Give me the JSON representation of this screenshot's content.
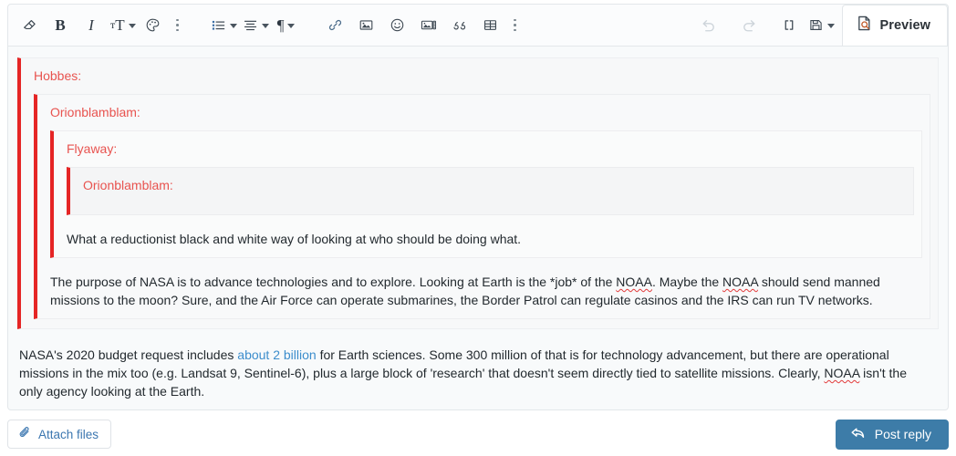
{
  "toolbar": {
    "groups": [
      {
        "name": "formatting",
        "buttons": [
          {
            "icon": "remove-format-icon",
            "label": "Remove formatting",
            "caret": false
          },
          {
            "icon": "bold-icon",
            "label": "Bold",
            "caret": false
          },
          {
            "icon": "italic-icon",
            "label": "Italic",
            "caret": false
          },
          {
            "icon": "font-size-icon",
            "label": "Font size",
            "caret": true
          },
          {
            "icon": "text-color-palette-icon",
            "label": "Text color",
            "caret": false
          },
          {
            "icon": "more-formatting-icon",
            "label": "More formatting options",
            "caret": false
          }
        ]
      },
      {
        "name": "paragraph",
        "buttons": [
          {
            "icon": "bulleted-list-icon",
            "label": "List",
            "caret": true
          },
          {
            "icon": "text-align-icon",
            "label": "Alignment",
            "caret": true
          },
          {
            "icon": "paragraph-format-icon",
            "label": "Paragraph format",
            "caret": true
          }
        ]
      },
      {
        "name": "insert",
        "buttons": [
          {
            "icon": "link-icon",
            "label": "Insert link",
            "caret": false
          },
          {
            "icon": "image-icon",
            "label": "Insert image",
            "caret": false
          },
          {
            "icon": "smiley-icon",
            "label": "Insert emoji",
            "caret": false
          },
          {
            "icon": "media-gallery-icon",
            "label": "Insert media",
            "caret": false
          },
          {
            "icon": "quote-icon",
            "label": "Insert quote",
            "caret": false
          },
          {
            "icon": "table-icon",
            "label": "Insert table",
            "caret": false
          },
          {
            "icon": "more-insert-icon",
            "label": "More insert options",
            "caret": false
          }
        ]
      },
      {
        "name": "history",
        "buttons": [
          {
            "icon": "undo-icon",
            "label": "Undo",
            "caret": false,
            "disabled": true
          },
          {
            "icon": "redo-icon",
            "label": "Redo",
            "caret": false,
            "disabled": true
          },
          {
            "icon": "brackets-icon",
            "label": "Insert BB code",
            "caret": false
          },
          {
            "icon": "save-draft-icon",
            "label": "Drafts",
            "caret": true
          }
        ]
      }
    ],
    "preview_label": "Preview",
    "preview_icon": "document-preview-icon"
  },
  "editor": {
    "quotes": [
      {
        "level": 1,
        "author": "Hobbes:"
      },
      {
        "level": 2,
        "author": "Orionblamblam:"
      },
      {
        "level": 3,
        "author": "Flyaway:"
      },
      {
        "level": 4,
        "author": "Orionblamblam:"
      }
    ],
    "quote_level3_body": "What a reductionist black and white way of looking at who should be doing what.",
    "quote_level2_body_parts": {
      "p1": "The purpose of NASA is to advance technologies and to explore. Looking at Earth is the *job* of the ",
      "misspelled1": "NOAA",
      "p2": ". Maybe the ",
      "misspelled2": "NOAA",
      "p3": " should send manned missions to the moon? Sure, and the Air Force can operate submarines, the Border Patrol can regulate casinos and the IRS can run TV networks."
    },
    "root_paragraph_parts": {
      "p1": "NASA's 2020 budget request includes ",
      "link": "about 2 billion",
      "p2": " for Earth sciences. Some 300 million of that is for technology advancement, but there are operational missions in the mix too (e.g. Landsat 9, Sentinel-6), plus a large block of 'research' that doesn't seem directly tied to satellite missions. Clearly, ",
      "misspelled1": "NOAA",
      "p3": " isn't the only agency looking at the Earth."
    }
  },
  "footer": {
    "attach_label": "Attach files",
    "attach_icon": "paperclip-icon",
    "post_label": "Post reply",
    "post_icon": "reply-arrow-icon"
  },
  "colors": {
    "quote_bar": "#e52525",
    "quote_author": "#e8534f",
    "link": "#3c8dcc",
    "primary_button": "#3d7ca8",
    "attach_text": "#3c77b0",
    "spellcheck_underline": "#e23b3b"
  }
}
